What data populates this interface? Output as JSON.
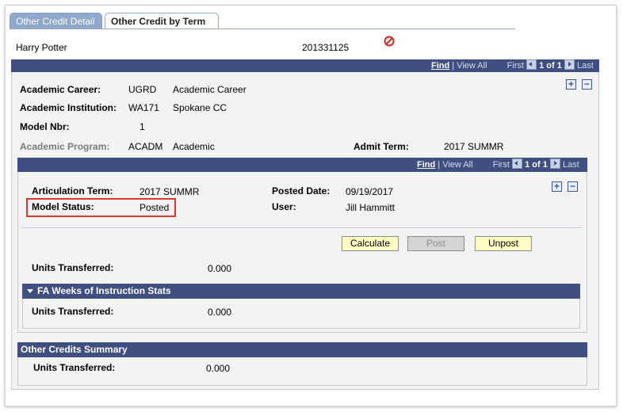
{
  "tabs": [
    {
      "label": "Other Credit Detail",
      "active": false
    },
    {
      "label": "Other Credit by Term",
      "active": true
    }
  ],
  "student": {
    "name": "Harry Potter",
    "id": "201331125",
    "status_icon": "prohibited-icon"
  },
  "outer_nav": {
    "find": "Find",
    "view_all": "View All",
    "first": "First",
    "count": "1 of 1",
    "last": "Last"
  },
  "career": {
    "academic_career": {
      "label": "Academic Career:",
      "code": "UGRD",
      "desc": "Academic Career"
    },
    "academic_institution": {
      "label": "Academic Institution:",
      "code": "WA171",
      "desc": "Spokane CC"
    },
    "model_nbr": {
      "label": "Model Nbr:",
      "value": "1"
    },
    "academic_program": {
      "label": "Academic Program:",
      "code": "ACADM",
      "desc": "Academic"
    },
    "admit_term": {
      "label": "Admit Term:",
      "value": "2017 SUMMR"
    }
  },
  "inner_nav": {
    "find": "Find",
    "view_all": "View All",
    "first": "First",
    "count": "1 of 1",
    "last": "Last"
  },
  "articulation": {
    "term": {
      "label": "Articulation Term:",
      "value": "2017 SUMMR"
    },
    "posted_date": {
      "label": "Posted Date:",
      "value": "09/19/2017"
    },
    "model_status": {
      "label": "Model Status:",
      "value": "Posted"
    },
    "user": {
      "label": "User:",
      "value": "Jill Hammitt"
    }
  },
  "buttons": {
    "calculate": "Calculate",
    "post": "Post",
    "unpost": "Unpost"
  },
  "units_transferred": {
    "label": "Units Transferred:",
    "value": "0.000"
  },
  "fa_weeks": {
    "title": "FA Weeks of Instruction Stats",
    "label": "Units Transferred:",
    "value": "0.000"
  },
  "summary": {
    "title": "Other Credits Summary",
    "label": "Units Transferred:",
    "value": "0.000"
  },
  "colors": {
    "header_bar": "#3e4f80",
    "tab_inactive": "#8fa8cc",
    "highlight": "#d9382c",
    "button_yellow": "#ffffc4"
  }
}
